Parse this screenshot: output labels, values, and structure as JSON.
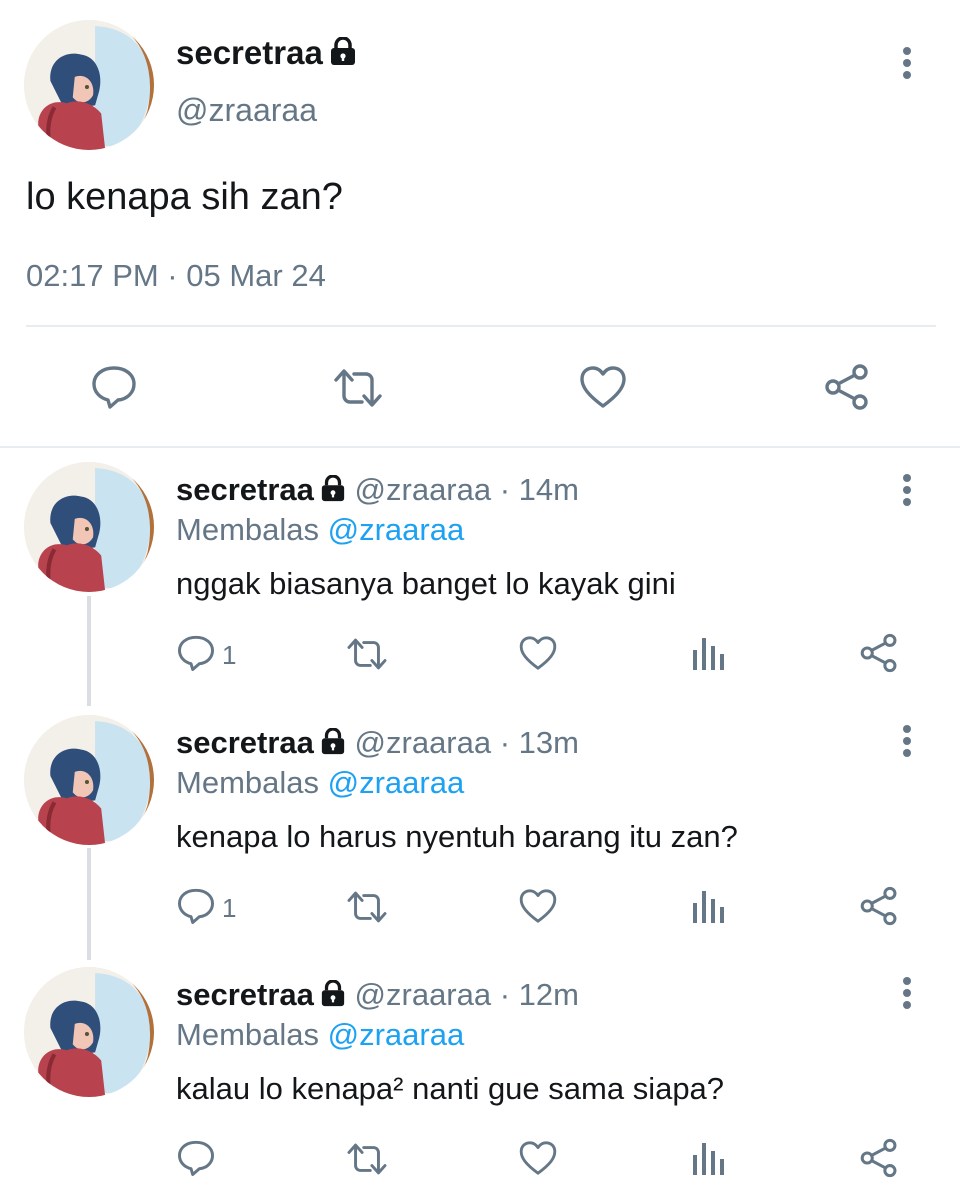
{
  "main_tweet": {
    "name": "secretraa",
    "handle": "@zraaraa",
    "text": "lo kenapa sih zan?",
    "timestamp": "02:17 PM · 05 Mar 24"
  },
  "replies": [
    {
      "name": "secretraa",
      "handle": "@zraaraa",
      "time": "· 14m",
      "reply_prefix": "Membalas",
      "reply_to": "@zraaraa",
      "text": "nggak biasanya banget lo kayak gini",
      "reply_count": "1"
    },
    {
      "name": "secretraa",
      "handle": "@zraaraa",
      "time": "· 13m",
      "reply_prefix": "Membalas",
      "reply_to": "@zraaraa",
      "text": "kenapa lo harus nyentuh barang itu zan?",
      "reply_count": "1"
    },
    {
      "name": "secretraa",
      "handle": "@zraaraa",
      "time": "· 12m",
      "reply_prefix": "Membalas",
      "reply_to": "@zraaraa",
      "text": "kalau lo kenapa² nanti gue sama siapa?",
      "reply_count": ""
    }
  ],
  "icons": {
    "lock": "lock-icon",
    "reply": "reply-icon",
    "retweet": "retweet-icon",
    "like": "like-icon",
    "analytics": "analytics-icon",
    "share": "share-icon",
    "more": "more-vertical-icon"
  },
  "colors": {
    "text": "#14171a",
    "muted": "#657786",
    "link": "#1da1f2",
    "divider": "#e6ecf0"
  }
}
